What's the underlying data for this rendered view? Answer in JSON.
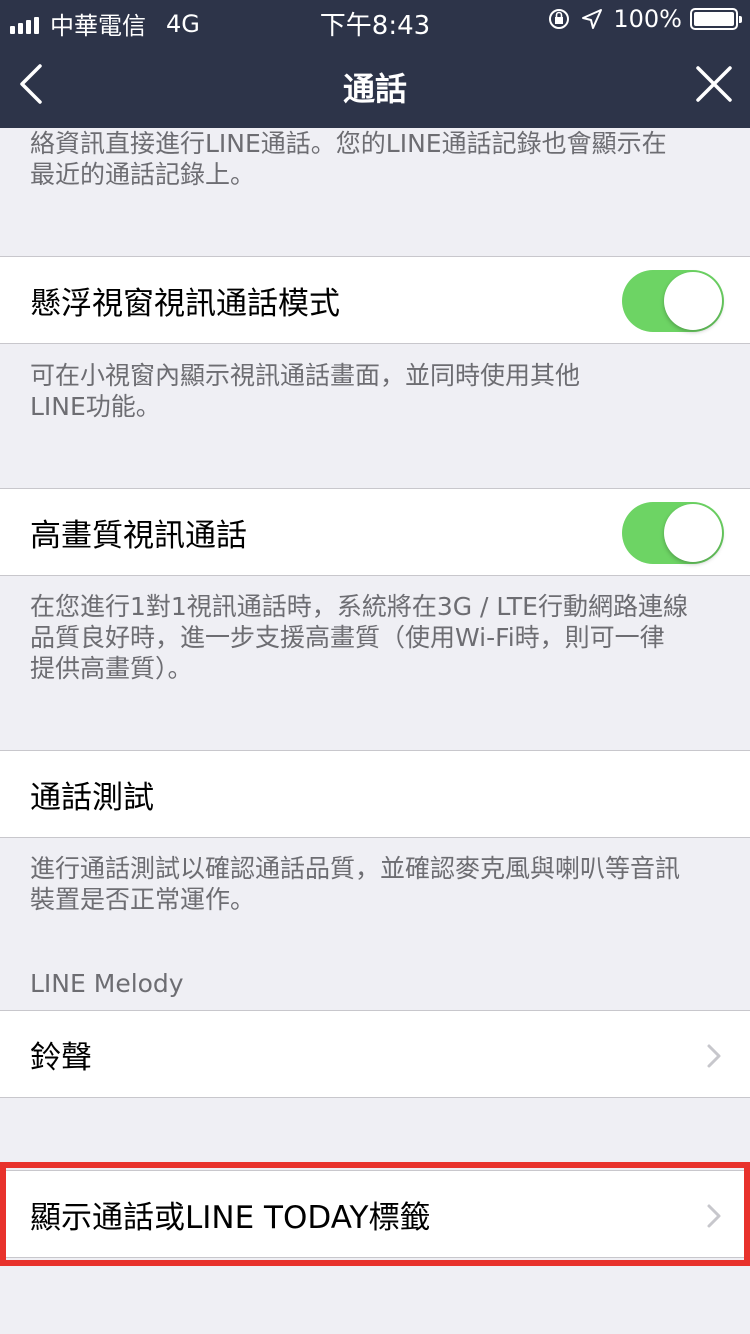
{
  "status_bar": {
    "carrier": "中華電信",
    "network": "4G",
    "time": "下午8:43",
    "battery": "100%"
  },
  "nav": {
    "title": "通話",
    "back_icon": "chevron-left-icon",
    "close_icon": "close-icon"
  },
  "intro_desc": {
    "line1": "絡資訊直接進行LINE通話。您的LINE通話記錄也會顯示在",
    "line2": "最近的通話記錄上。"
  },
  "settings": [
    {
      "label": "懸浮視窗視訊通話模式",
      "toggle_on": true,
      "desc_lines": [
        "可在小視窗內顯示視訊通話畫面，並同時使用其他",
        "LINE功能。"
      ]
    },
    {
      "label": "高畫質視訊通話",
      "toggle_on": true,
      "desc_lines": [
        "在您進行1對1視訊通話時，系統將在3G / LTE行動網路連線",
        "品質良好時，進一步支援高畫質（使用Wi-Fi時，則可一律",
        "提供高畫質）。"
      ]
    },
    {
      "label": "通話測試",
      "desc_lines": [
        "進行通話測試以確認通話品質，並確認麥克風與喇叭等音訊",
        "裝置是否正常運作。"
      ]
    }
  ],
  "line_melody": {
    "header": "LINE Melody",
    "ringtone_label": "鈴聲"
  },
  "show_tab": {
    "label": "顯示通話或LINE TODAY標籤"
  },
  "colors": {
    "nav_bg": "#2d3449",
    "toggle_on": "#6dd464",
    "highlight": "#e8322c"
  }
}
